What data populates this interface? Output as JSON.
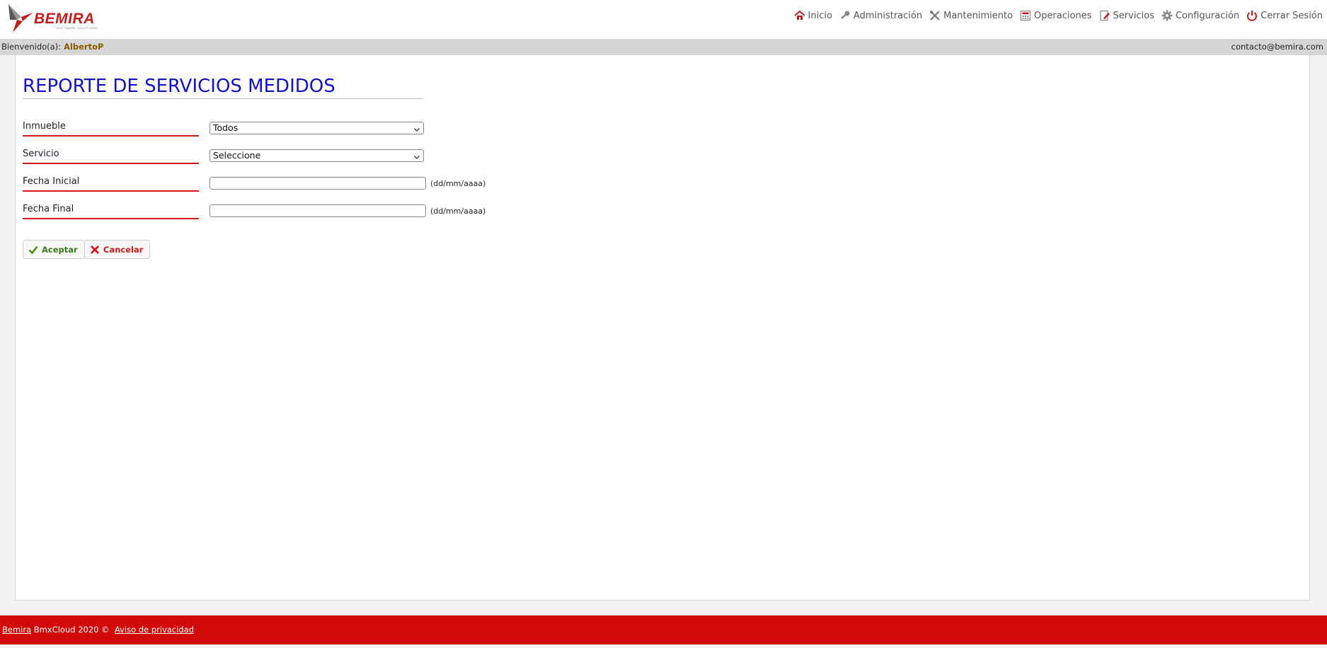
{
  "brand": {
    "logo_text": "BEMIRA",
    "logo_tagline": "SOFTWARE SOLUTIONS"
  },
  "nav": [
    {
      "label": "Inicio",
      "icon": "home-icon"
    },
    {
      "label": "Administración",
      "icon": "key-icon"
    },
    {
      "label": "Mantenimiento",
      "icon": "tools-icon"
    },
    {
      "label": "Operaciones",
      "icon": "calculator-icon"
    },
    {
      "label": "Servicios",
      "icon": "document-edit-icon"
    },
    {
      "label": "Configuración",
      "icon": "gear-icon"
    },
    {
      "label": "Cerrar Sesión",
      "icon": "power-icon"
    }
  ],
  "userbar": {
    "welcome_label": "Bienvenido(a):",
    "username": "AlbertoP",
    "contact_email": "contacto@bemira.com"
  },
  "page": {
    "title": "REPORTE DE SERVICIOS MEDIDOS"
  },
  "form": {
    "inmueble": {
      "label": "Inmueble",
      "selected": "Todos"
    },
    "servicio": {
      "label": "Servicio",
      "selected": "Seleccione"
    },
    "fecha_inicial": {
      "label": "Fecha Inicial",
      "value": "",
      "hint": "(dd/mm/aaaa)"
    },
    "fecha_final": {
      "label": "Fecha Final",
      "value": "",
      "hint": "(dd/mm/aaaa)"
    }
  },
  "buttons": {
    "accept_label": "Aceptar",
    "cancel_label": "Cancelar"
  },
  "footer": {
    "brand_link": "Bemira",
    "copyright_text": "BmxCloud 2020 ©",
    "privacy_link": "Aviso de privacidad"
  },
  "colors": {
    "accent_red": "#d10909",
    "title_blue": "#1111cc",
    "username_brown": "#8b5a00",
    "accept_green": "#3a7a1a"
  }
}
